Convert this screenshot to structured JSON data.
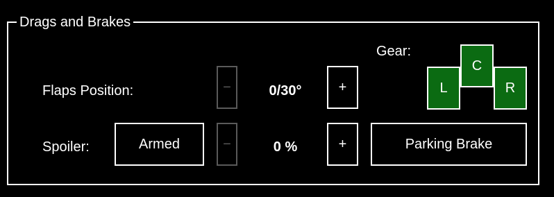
{
  "panel": {
    "title": "Drags and Brakes"
  },
  "flaps": {
    "label": "Flaps Position:",
    "decrease_label": "−",
    "value": "0/30°",
    "increase_label": "+"
  },
  "spoiler": {
    "label": "Spoiler:",
    "mode_button_label": "Armed",
    "decrease_label": "−",
    "value": "0 %",
    "increase_label": "+"
  },
  "gear": {
    "label": "Gear:",
    "left_label": "L",
    "center_label": "C",
    "right_label": "R",
    "indicator_color": "#0b6b12"
  },
  "parking_brake": {
    "label": "Parking Brake"
  },
  "colors": {
    "background": "#000000",
    "foreground": "#ffffff",
    "disabled": "#5a5a5a",
    "gear_down": "#0b6b12"
  }
}
